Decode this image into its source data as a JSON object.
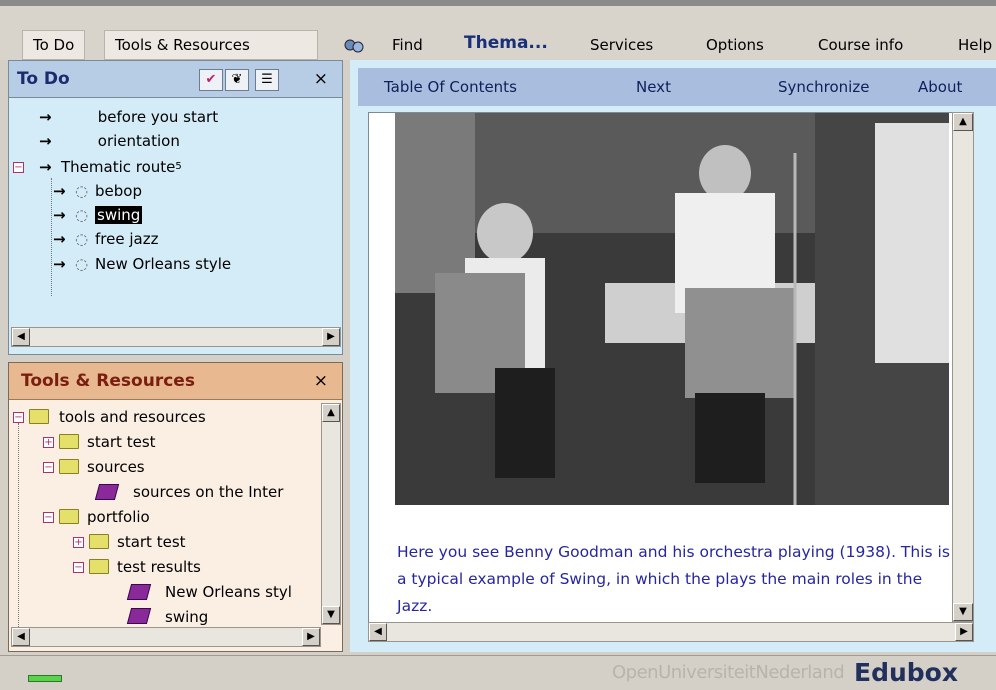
{
  "menu": {
    "todo": "To Do",
    "tools": "Tools & Resources",
    "find": "Find",
    "thema": "Thema...",
    "services": "Services",
    "options": "Options",
    "course_info": "Course info",
    "help": "Help"
  },
  "todo": {
    "title": "To Do",
    "close": "×",
    "items": [
      {
        "label": "before you start"
      },
      {
        "label": "orientation"
      },
      {
        "label": "Thematic route",
        "sup": "5"
      },
      {
        "label": "bebop"
      },
      {
        "label": "swing"
      },
      {
        "label": "free jazz"
      },
      {
        "label": "New Orleans style"
      }
    ]
  },
  "tools": {
    "title": "Tools & Resources",
    "close": "×",
    "items": [
      {
        "label": "tools and resources"
      },
      {
        "label": "start test"
      },
      {
        "label": "sources"
      },
      {
        "label": "sources on the Inter"
      },
      {
        "label": "portfolio"
      },
      {
        "label": "start test"
      },
      {
        "label": "test results"
      },
      {
        "label": "New Orleans styl"
      },
      {
        "label": "swing"
      }
    ]
  },
  "nav": {
    "toc": "Table Of Contents",
    "next": "Next",
    "sync": "Synchronize",
    "about": "About"
  },
  "content": {
    "caption": "Here you see Benny Goodman and his orchestra playing (1938). This is a typical example of Swing, in which the plays the main roles in the Jazz."
  },
  "footer": {
    "brand_small": "OpenUniversiteitNederland",
    "brand": "Edubox"
  }
}
